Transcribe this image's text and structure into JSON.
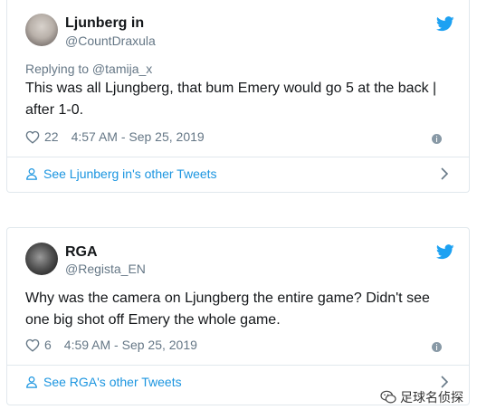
{
  "tweets": [
    {
      "name": "Ljunberg in",
      "handle": "@CountDraxula",
      "replying": "Replying to @tamija_x",
      "text": "This was all Ljungberg, that bum Emery would go 5 at the back | after 1-0.",
      "likes": "22",
      "timestamp": "4:57 AM - Sep 25, 2019",
      "see_link": "See Ljunberg in's other Tweets"
    },
    {
      "name": "RGA",
      "handle": "@Regista_EN",
      "text": "Why was the camera on Ljungberg the entire game? Didn't see one big shot off Emery the whole game.",
      "likes": "6",
      "timestamp": "4:59 AM - Sep 25, 2019",
      "see_link": "See RGA's other Tweets"
    }
  ],
  "watermark": "足球名侦探",
  "colors": {
    "link": "#1b95e0",
    "muted": "#657786",
    "border": "#e1e8ed",
    "twitter_blue": "#1da1f2"
  },
  "icons": [
    "twitter-bird-icon",
    "heart-icon",
    "info-icon",
    "person-icon",
    "chevron-right-icon",
    "wechat-icon"
  ]
}
